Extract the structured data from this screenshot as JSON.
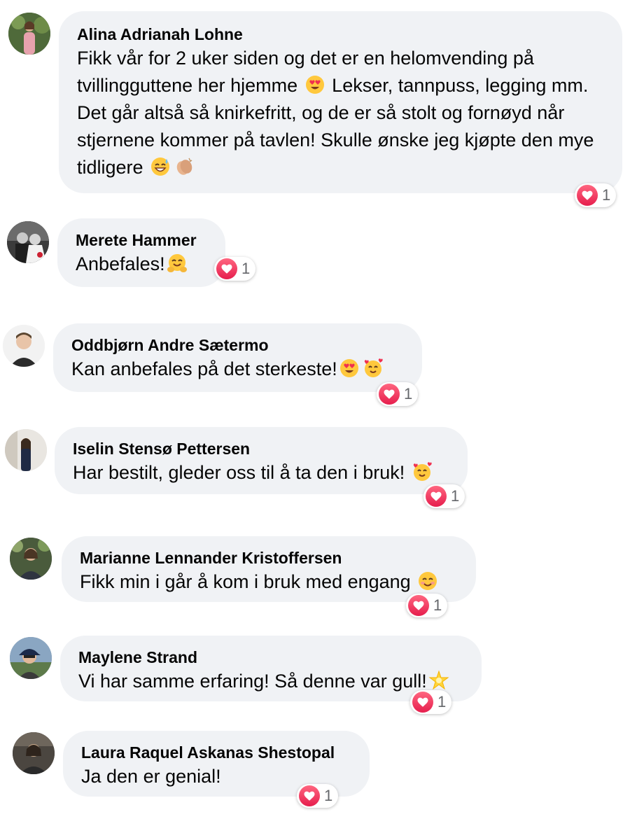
{
  "colors": {
    "bubble_bg": "#f0f2f5",
    "text": "#050505",
    "count_text": "#65676b",
    "love_reaction": "#f33e58"
  },
  "comments": [
    {
      "author": "Alina Adrianah Lohne",
      "text_parts": [
        "Fikk vår for 2 uker siden og det er en helomvending på tvillingguttene her hjemme ",
        " Lekser, tannpuss, legging mm. Det går altså så knirkefritt, og de er så stolt og fornøyd når stjernene kommer på tavlen! Skulle ønske jeg kjøpte den mye tidligere "
      ],
      "emojis": [
        "heart-eyes-emoji",
        "sweat-smile-emoji",
        "clapping-hands-emoji"
      ],
      "reaction": {
        "icon": "heart-icon",
        "count": "1"
      }
    },
    {
      "author": "Merete Hammer",
      "text_parts": [
        "Anbefales!"
      ],
      "emojis": [
        "hugging-face-emoji"
      ],
      "reaction": {
        "icon": "heart-icon",
        "count": "1"
      }
    },
    {
      "author": "Oddbjørn Andre Sætermo",
      "text_parts": [
        "Kan anbefales på det sterkeste!"
      ],
      "emojis": [
        "heart-eyes-emoji",
        "smiling-face-with-hearts-emoji"
      ],
      "reaction": {
        "icon": "heart-icon",
        "count": "1"
      }
    },
    {
      "author": "Iselin Stensø Pettersen",
      "text_parts": [
        "Har bestilt, gleder oss til å ta den i bruk! "
      ],
      "emojis": [
        "smiling-face-with-hearts-emoji"
      ],
      "reaction": {
        "icon": "heart-icon",
        "count": "1"
      }
    },
    {
      "author": "Marianne Lennander Kristoffersen",
      "text_parts": [
        "Fikk min i går å kom i bruk med engang "
      ],
      "emojis": [
        "smiling-blush-emoji"
      ],
      "reaction": {
        "icon": "heart-icon",
        "count": "1"
      }
    },
    {
      "author": "Maylene Strand",
      "text_parts": [
        "Vi har samme erfaring! Så denne var gull!"
      ],
      "emojis": [
        "glowing-star-emoji"
      ],
      "reaction": {
        "icon": "heart-icon",
        "count": "1"
      }
    },
    {
      "author": "Laura Raquel Askanas Shestopal",
      "text_parts": [
        "Ja den er genial!"
      ],
      "emojis": [],
      "reaction": {
        "icon": "heart-icon",
        "count": "1"
      }
    }
  ]
}
